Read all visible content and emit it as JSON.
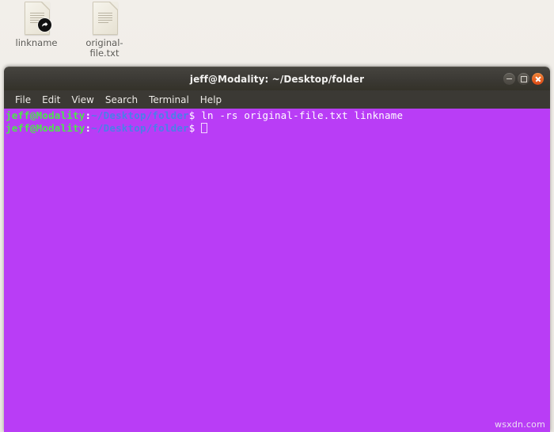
{
  "desktop": {
    "background_color": "#efece7",
    "icons": [
      {
        "label": "linkname",
        "icon": "document-symlink-icon",
        "type": "symlink"
      },
      {
        "label": "original-file.txt",
        "icon": "document-text-icon",
        "type": "file"
      }
    ]
  },
  "terminal": {
    "title": "jeff@Modality: ~/Desktop/folder",
    "window_controls": [
      {
        "name": "minimize",
        "glyph": "–"
      },
      {
        "name": "maximize",
        "glyph": "□"
      },
      {
        "name": "close",
        "glyph": "✕",
        "color": "#dd4814"
      }
    ],
    "menu": [
      {
        "label": "File"
      },
      {
        "label": "Edit"
      },
      {
        "label": "View"
      },
      {
        "label": "Search"
      },
      {
        "label": "Terminal"
      },
      {
        "label": "Help"
      }
    ],
    "background_color": "#b93df6",
    "colors": {
      "user_host": "#4ee44e",
      "path": "#4a7fe8",
      "text": "#ffffff"
    },
    "lines": [
      {
        "user_host": "jeff@Modality",
        "colon": ":",
        "path": "~/Desktop/folder",
        "dollar": "$ ",
        "command": "ln -rs original-file.txt linkname",
        "cursor": false
      },
      {
        "user_host": "jeff@Modality",
        "colon": ":",
        "path": "~/Desktop/folder",
        "dollar": "$ ",
        "command": "",
        "cursor": true
      }
    ]
  },
  "watermark": "wsxdn.com"
}
